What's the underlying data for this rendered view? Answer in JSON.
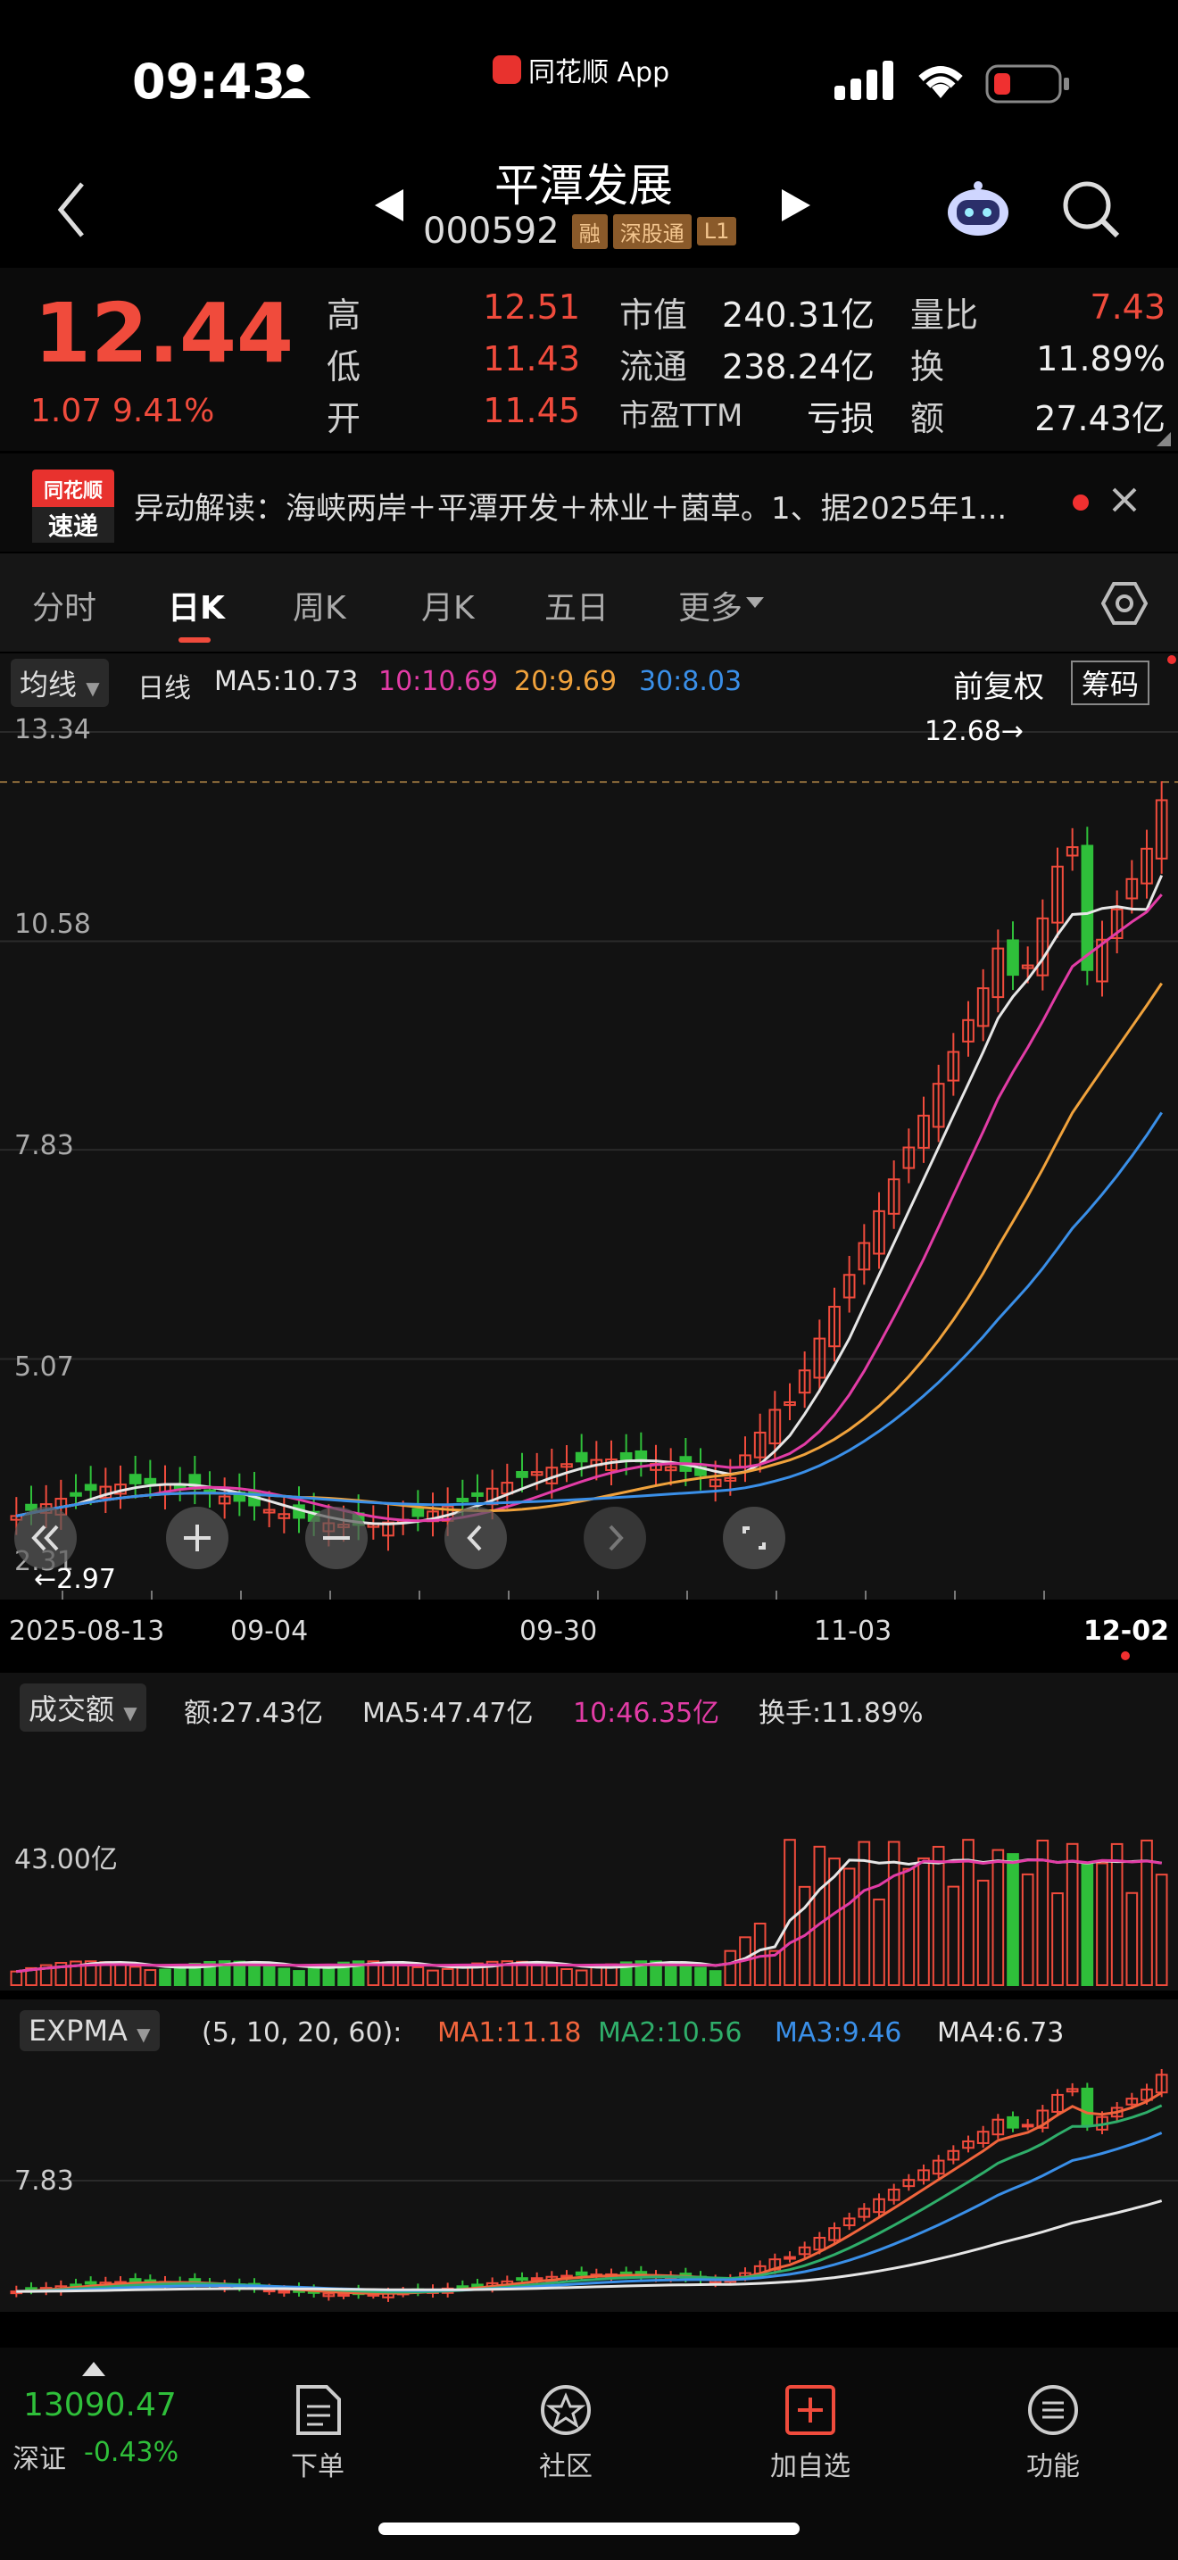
{
  "status": {
    "time": "09:43",
    "app_label": "同花顺 App"
  },
  "header": {
    "title": "平潭发展",
    "code": "000592",
    "tags": [
      "融",
      "深股通",
      "L1"
    ]
  },
  "quote": {
    "price": "12.44",
    "change": "1.07",
    "change_pct": "9.41%",
    "rows": [
      [
        {
          "label": "高",
          "value": "12.51",
          "color": "#f04b3c"
        },
        {
          "label": "市值",
          "value": "240.31亿"
        },
        {
          "label": "量比",
          "value": "7.43",
          "color": "#f04b3c"
        }
      ],
      [
        {
          "label": "低",
          "value": "11.43",
          "color": "#f04b3c"
        },
        {
          "label": "流通",
          "value": "238.24亿"
        },
        {
          "label": "换",
          "value": "11.89%"
        }
      ],
      [
        {
          "label": "开",
          "value": "11.45",
          "color": "#f04b3c"
        },
        {
          "label": "市盈TTM",
          "value": "亏损"
        },
        {
          "label": "额",
          "value": "27.43亿"
        }
      ]
    ]
  },
  "news": {
    "logo_top": "同花顺",
    "logo_bottom": "速递",
    "text": "异动解读：海峡两岸＋平潭开发＋林业＋菌草。1、据2025年1..."
  },
  "tabs": [
    "分时",
    "日K",
    "周K",
    "月K",
    "五日",
    "更多"
  ],
  "active_tab": 1,
  "kline": {
    "indicator": "均线",
    "period": "日线",
    "ma": [
      {
        "text": "MA5:10.73",
        "color": "#e6e6e6"
      },
      {
        "text": "10:10.69",
        "color": "#e23ca6"
      },
      {
        "text": "20:9.69",
        "color": "#f0a23c"
      },
      {
        "text": "30:8.03",
        "color": "#3a8fe8"
      }
    ],
    "adjust": "前复权",
    "chip": "筹码",
    "y_ticks": [
      "13.34",
      "10.58",
      "7.83",
      "5.07",
      "2.31"
    ],
    "max_label": "12.68→",
    "min_label": "←2.97",
    "dates": [
      "2025-08-13",
      "09-04",
      "09-30",
      "11-03",
      "12-02"
    ]
  },
  "volume": {
    "indicator": "成交额",
    "amount": "额:27.43亿",
    "ma5": "MA5:47.47亿",
    "ma10": "10:46.35亿",
    "turnover": "换手:11.89%",
    "y_label": "43.00亿"
  },
  "expma": {
    "indicator": "EXPMA",
    "params": "(5, 10, 20, 60):",
    "lines": [
      {
        "text": "MA1:11.18",
        "color": "#f0643c"
      },
      {
        "text": "MA2:10.56",
        "color": "#2fae6a"
      },
      {
        "text": "MA3:9.46",
        "color": "#3a8fe8"
      },
      {
        "text": "MA4:6.73",
        "color": "#e6e6e6"
      }
    ],
    "y_label": "7.83"
  },
  "chart_data": {
    "type": "candlestick",
    "x": [
      "2025-08-13",
      "09-04",
      "09-30",
      "11-03",
      "12-02"
    ],
    "ylim": [
      2.31,
      13.34
    ],
    "max": 12.68,
    "min": 2.97,
    "last_close": 12.44,
    "series": [
      {
        "name": "MA5",
        "value": 10.73
      },
      {
        "name": "MA10",
        "value": 10.69
      },
      {
        "name": "MA20",
        "value": 9.69
      },
      {
        "name": "MA30",
        "value": 8.03
      }
    ]
  },
  "index": {
    "value": "13090.47",
    "name": "深证",
    "change": "-0.43%"
  },
  "bottom": [
    "下单",
    "社区",
    "加自选",
    "功能"
  ],
  "colors": {
    "up": "#f04b3c",
    "down": "#2fbf3a",
    "bg": "#000000"
  }
}
